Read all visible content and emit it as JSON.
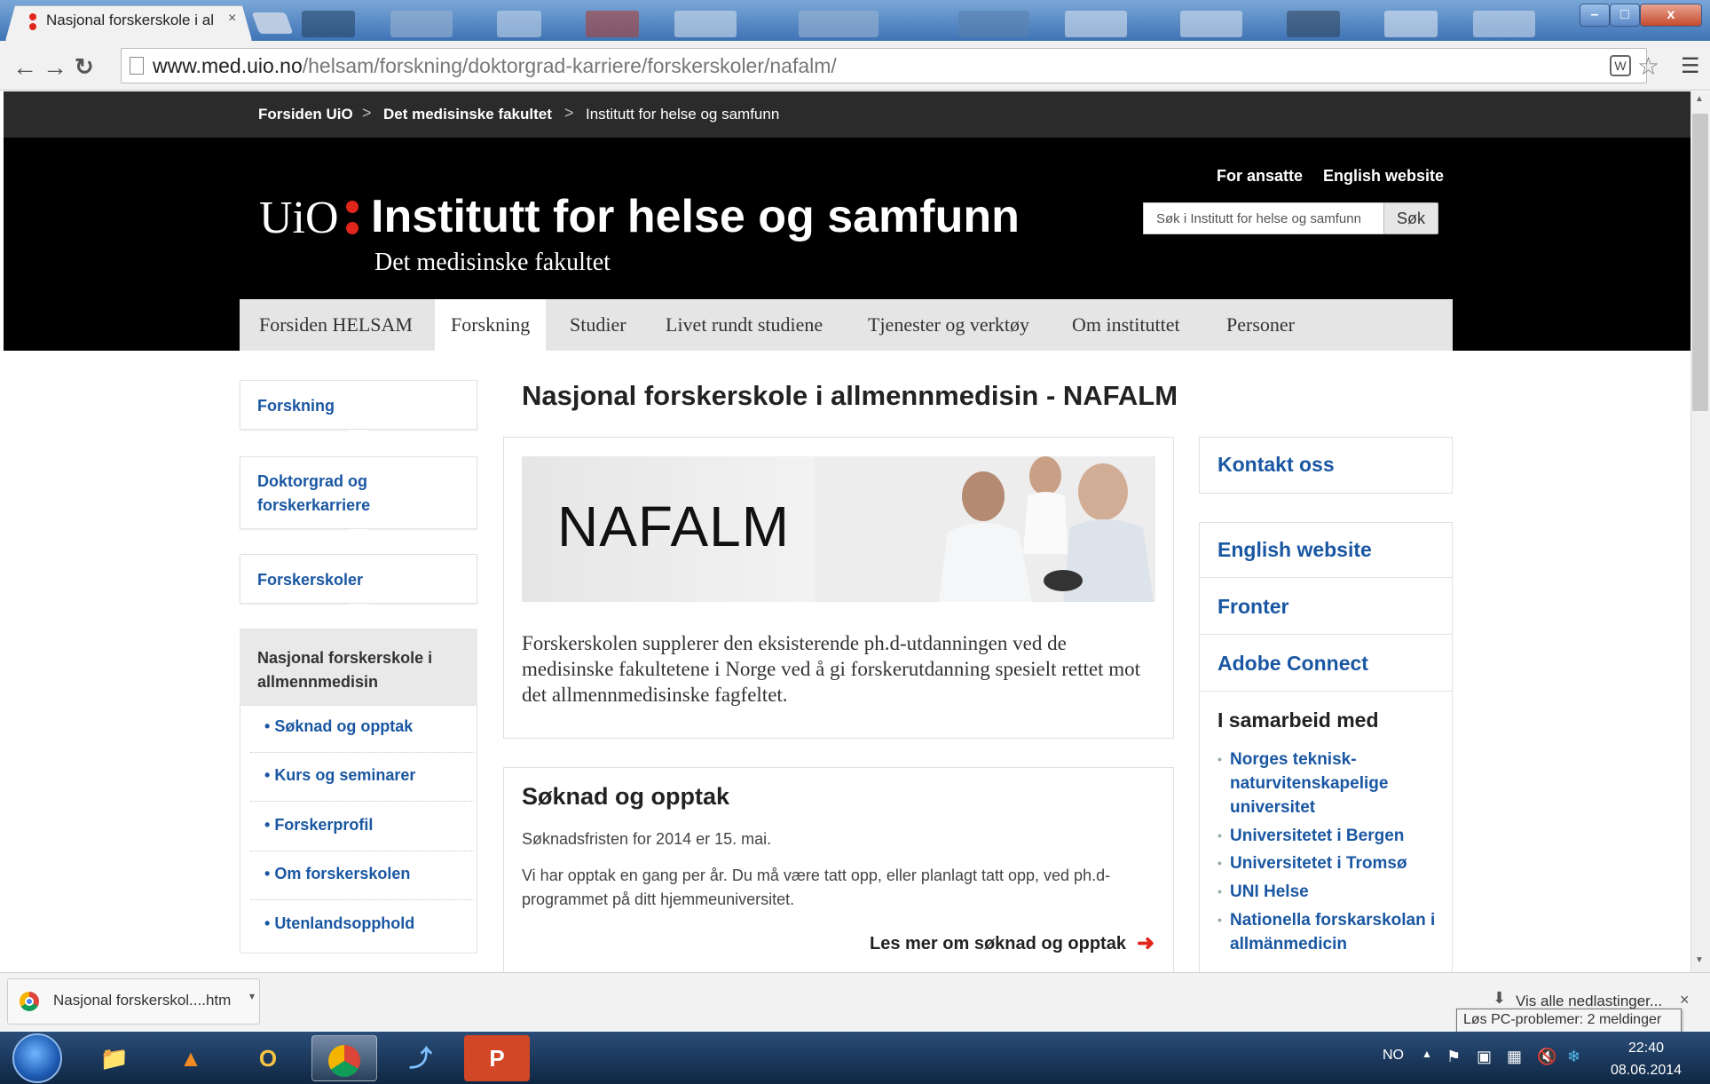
{
  "browser": {
    "tab_title": "Nasjonal forskerskole i allı",
    "tab_close": "×",
    "url_host": "www.med.uio.no",
    "url_path": "/helsam/forskning/doktorgrad-karriere/forskerskoler/nafalm/",
    "window_controls": {
      "minimize": "–",
      "maximize": "□",
      "close": "x"
    }
  },
  "breadcrumb": {
    "items": [
      "Forsiden UiO",
      "Det medisinske fakultet",
      "Institutt for helse og samfunn"
    ],
    "separator": ">"
  },
  "header": {
    "logo": "UiO",
    "title": "Institutt for helse og samfunn",
    "subtitle": "Det medisinske fakultet",
    "top_links": [
      "For ansatte",
      "English website"
    ],
    "search_placeholder": "Søk i Institutt for helse og samfunn",
    "search_button": "Søk"
  },
  "nav": {
    "items": [
      "Forsiden HELSAM",
      "Forskning",
      "Studier",
      "Livet rundt studiene",
      "Tjenester og verktøy",
      "Om instituttet",
      "Personer"
    ],
    "active_index": 1
  },
  "subnav": {
    "levels": [
      "Forskning",
      "Doktorgrad og forskerkarriere",
      "Forskerskoler"
    ],
    "current": "Nasjonal forskerskole i allmennmedisin",
    "children": [
      "Søknad og opptak",
      "Kurs og seminarer",
      "Forskerprofil",
      "Om forskerskolen",
      "Utenlandsopphold"
    ]
  },
  "main": {
    "title": "Nasjonal forskerskole i allmennmedisin - NAFALM",
    "banner_text": "NAFALM",
    "intro": "Forskerskolen supplerer den eksisterende ph.d-utdanningen ved de medisinske fakultetene i Norge ved å gi forskerutdanning spesielt rettet mot det allmennmedisinske fagfeltet.",
    "apply": {
      "title": "Søknad og opptak",
      "p1": "Søknadsfristen for 2014 er 15. mai.",
      "p2": "Vi har opptak en gang per år. Du må være tatt opp, eller planlagt tatt opp, ved ph.d-programmet på ditt hjemmeuniversitet.",
      "more": "Les mer om søknad og opptak"
    }
  },
  "sidebar": {
    "contact": "Kontakt oss",
    "links": [
      "English website",
      "Fronter",
      "Adobe Connect"
    ],
    "partners_heading": "I samarbeid med",
    "partners": [
      "Norges teknisk-naturvitenskapelige universitet",
      "Universitetet i Bergen",
      "Universitetet i Tromsø",
      "UNI Helse",
      "Nationella forskarskolan i allmänmedicin"
    ]
  },
  "downloads": {
    "file": "Nasjonal forskerskol....htm",
    "show_all": "Vis alle nedlastinger...",
    "close": "×",
    "tooltip": "Løs PC-problemer: 2 meldinger"
  },
  "taskbar": {
    "lang": "NO",
    "time": "22:40",
    "date": "08.06.2014"
  },
  "colors": {
    "link": "#1a57a2",
    "header_bg": "#000000",
    "accent_red": "#e0261b"
  }
}
